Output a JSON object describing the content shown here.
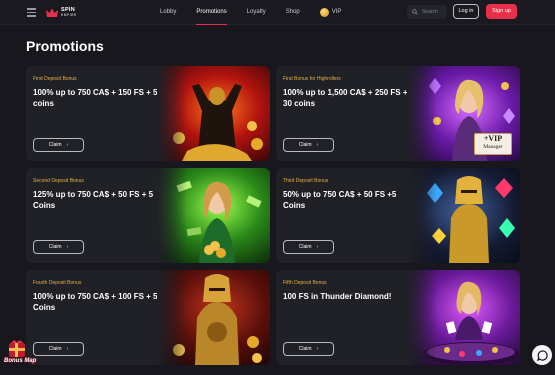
{
  "header": {
    "logo": {
      "line1": "SPIN",
      "line2": "EMPIRE"
    },
    "nav": [
      {
        "label": "Lobby",
        "active": false
      },
      {
        "label": "Promotions",
        "active": true
      },
      {
        "label": "Loyalty",
        "active": false
      },
      {
        "label": "Shop",
        "active": false
      },
      {
        "label": "VIP",
        "active": false
      }
    ],
    "search_placeholder": "Search",
    "login_label": "Log in",
    "signup_label": "Sign up"
  },
  "page_title": "Promotions",
  "cards": [
    {
      "label": "First Deposit Bonus",
      "title": "100% up to 750 CA$ + 150 FS + 5 coins",
      "claim": "Claim",
      "icon": "knight-gold-coins-image"
    },
    {
      "label": "First Bonus for Highrollers",
      "title": "100% up to 1,500 CA$ + 250 FS + 30 coins",
      "claim": "Claim",
      "icon": "vip-manager-woman-image",
      "sign": {
        "line1": "+VIP",
        "line2": "Manager"
      }
    },
    {
      "label": "Second Deposit Bonus",
      "title": "125% up to 750 CA$ + 50 FS + 5 Coins",
      "claim": "Claim",
      "icon": "woman-green-money-image"
    },
    {
      "label": "Third Deposit Bonus",
      "title": "50% up to 750 CA$ + 50 FS +5 Coins",
      "claim": "Claim",
      "icon": "gold-knight-gems-image"
    },
    {
      "label": "Fourth Deposit Bonus",
      "title": "100% up to 750 CA$ + 100 FS + 5 Coins",
      "claim": "Claim",
      "icon": "armored-knight-image"
    },
    {
      "label": "Fifth Deposit Bonus",
      "title": "100 FS in Thunder Diamond!",
      "claim": "Claim",
      "icon": "woman-casino-table-image"
    }
  ],
  "widgets": {
    "bonus_map_label": "Bonus Map",
    "chat_icon": "chat-icon"
  },
  "colors": {
    "accent": "#e8304b",
    "label": "#e3b341",
    "background": "#17171d",
    "card": "#202027"
  }
}
